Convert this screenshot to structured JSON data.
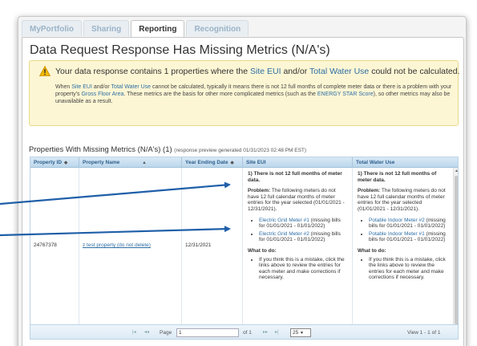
{
  "tabs": [
    {
      "label": "MyPortfolio",
      "active": false
    },
    {
      "label": "Sharing",
      "active": false
    },
    {
      "label": "Reporting",
      "active": true
    },
    {
      "label": "Recognition",
      "active": false
    }
  ],
  "page_title": "Data Request Response Has Missing Metrics (N/A's)",
  "alert": {
    "main_prefix": "Your data response contains 1 properties where the ",
    "link_site_eui": "Site EUI",
    "main_mid": " and/or ",
    "link_total_water": "Total Water Use",
    "main_suffix": " could not be calculated.",
    "sub_1": "When ",
    "sub_link_site_eui": "Site EUI",
    "sub_2": " and/or ",
    "sub_link_total_water": "Total Water Use",
    "sub_3": " cannot be calculated, typically it means there is not 12 full months of complete meter data or there is a problem with your property's ",
    "sub_link_gfa": "Gross Floor Area",
    "sub_4": ". These metrics are the basis for other more complicated metrics (such as the ",
    "sub_link_energystar": "ENERGY STAR Score",
    "sub_5": "), so other metrics may also be unavailable as a result."
  },
  "section": {
    "title": "Properties With Missing Metrics (N/A's) (1)",
    "note": "(response preview generated 01/31/2023 02:48 PM EST)"
  },
  "table": {
    "headers": [
      "Property ID",
      "Property Name",
      "Year Ending Date",
      "Site EUI",
      "Total Water Use"
    ],
    "row": {
      "property_id": "24767378",
      "property_name": "z test property (do not delete)",
      "year_ending": "12/31/2021",
      "site_eui": {
        "issue": "1)  There is not 12 full months of meter data.",
        "problem_label": "Problem:",
        "problem_text": "The following meters do not have 12 full calendar months of meter entries for the year selected (01/01/2021 - 12/31/2021).",
        "meters": [
          {
            "name": "Electric Grid Meter #1",
            "note": "(missing bills for 01/01/2021 - 01/01/2022)"
          },
          {
            "name": "Electric Grid Meter #2",
            "note": "(missing bills for 01/01/2021 - 01/01/2022)"
          }
        ],
        "todo_label": "What to do:",
        "todo_text": "If you think this is a mistake, click the links above to review the entries for each meter and make corrections if necessary."
      },
      "total_water": {
        "issue": "1)  There is not 12 full months of meter data.",
        "problem_label": "Problem:",
        "problem_text": "The following meters do not have 12 full calendar months of meter entries for the year selected (01/01/2021 - 12/31/2021).",
        "meters": [
          {
            "name": "Potable Indoor Meter #2",
            "note": "(missing bills for 01/01/2021 - 01/01/2022)"
          },
          {
            "name": "Potable Indoor Meter #1",
            "note": "(missing bills for 01/01/2021 - 01/01/2022)"
          }
        ],
        "todo_label": "What to do:",
        "todo_text": "If you think this is a mistake, click the links above to review the entries for each meter and make corrections if necessary."
      }
    }
  },
  "pager": {
    "page_label": "Page",
    "page_value": "1",
    "of_label": "of 1",
    "per_page": "25",
    "view_text": "View 1 - 1 of 1"
  },
  "colors": {
    "link": "#2d6ea5",
    "alert_bg": "#fdf6d4",
    "header_text": "#2d5f8c",
    "arrow": "#1f5fa8"
  }
}
